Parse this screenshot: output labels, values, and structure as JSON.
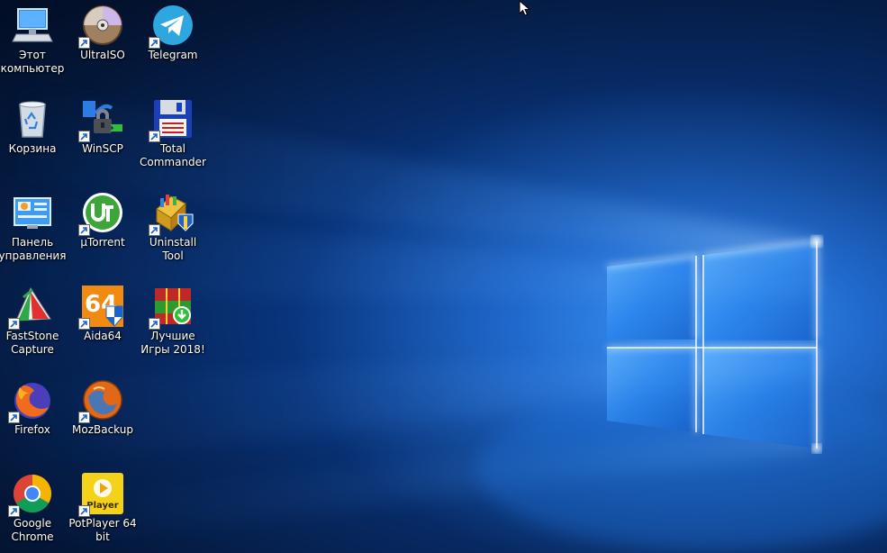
{
  "desktop": {
    "colors": {
      "wallpaper_light": "#cfe8ff",
      "wallpaper_mid": "#1f78e0",
      "wallpaper_dark": "#041739",
      "label_text": "#ffffff"
    },
    "icons": [
      {
        "id": "this-pc",
        "label": "Этот компьютер",
        "icon": "computer-icon",
        "shortcut": false
      },
      {
        "id": "ultraiso",
        "label": "UltraISO",
        "icon": "disc-icon",
        "shortcut": true
      },
      {
        "id": "telegram",
        "label": "Telegram",
        "icon": "telegram-icon",
        "shortcut": true
      },
      {
        "id": "recycle-bin",
        "label": "Корзина",
        "icon": "recycle-bin-icon",
        "shortcut": false
      },
      {
        "id": "winscp",
        "label": "WinSCP",
        "icon": "lock-icon",
        "shortcut": true
      },
      {
        "id": "total-commander",
        "label": "Total Commander",
        "icon": "floppy-icon",
        "shortcut": true
      },
      {
        "id": "control-panel",
        "label": "Панель управления",
        "icon": "control-panel-icon",
        "shortcut": false
      },
      {
        "id": "utorrent",
        "label": "µTorrent",
        "icon": "utorrent-icon",
        "shortcut": true
      },
      {
        "id": "uninstall-tool",
        "label": "Uninstall Tool",
        "icon": "uninstall-tool-icon",
        "shortcut": true
      },
      {
        "id": "faststone",
        "label": "FastStone Capture",
        "icon": "faststone-icon",
        "shortcut": true
      },
      {
        "id": "aida64",
        "label": "Aida64",
        "icon": "aida64-icon",
        "shortcut": true
      },
      {
        "id": "best-games",
        "label": "Лучшие Игры 2018!",
        "icon": "games-box-icon",
        "shortcut": true
      },
      {
        "id": "firefox",
        "label": "Firefox",
        "icon": "firefox-icon",
        "shortcut": true
      },
      {
        "id": "mozbackup",
        "label": "MozBackup",
        "icon": "mozbackup-icon",
        "shortcut": true
      },
      {
        "id": "chrome",
        "label": "Google Chrome",
        "icon": "chrome-icon",
        "shortcut": true
      },
      {
        "id": "potplayer",
        "label": "PotPlayer 64 bit",
        "icon": "potplayer-icon",
        "shortcut": true
      }
    ],
    "aida_badge": "64",
    "potplayer_badge": "Player",
    "cursor_icon": "mouse-pointer-icon"
  }
}
